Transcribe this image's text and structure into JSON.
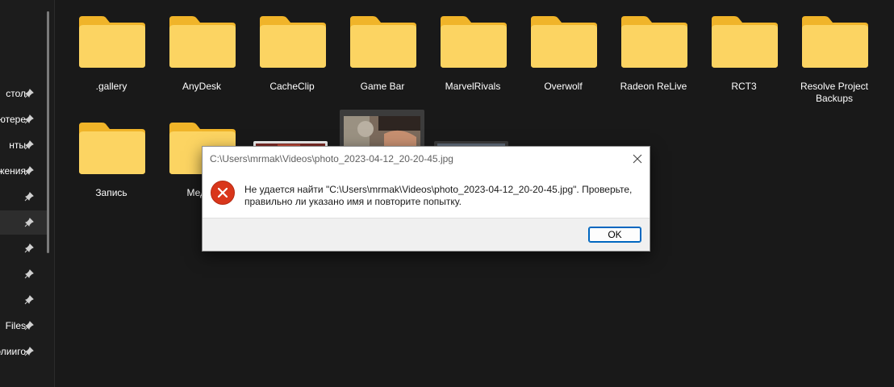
{
  "sidebar": {
    "items": [
      {
        "label": "стол"
      },
      {
        "label": "ьютере"
      },
      {
        "label": "нты"
      },
      {
        "label": "жения"
      },
      {
        "label": ""
      },
      {
        "label": ""
      },
      {
        "label": ""
      },
      {
        "label": ""
      },
      {
        "label": ""
      },
      {
        "label": "Files"
      },
      {
        "label": "олииго"
      }
    ],
    "selected_index": 5
  },
  "folders": [
    {
      "name": ".gallery"
    },
    {
      "name": "AnyDesk"
    },
    {
      "name": "CacheClip"
    },
    {
      "name": "Game Bar"
    },
    {
      "name": "MarvelRivals"
    },
    {
      "name": "Overwolf"
    },
    {
      "name": "Radeon ReLive"
    },
    {
      "name": "RCT3"
    },
    {
      "name": "Resolve Project Backups"
    },
    {
      "name": "Запись"
    },
    {
      "name": "Медиа"
    }
  ],
  "dialog": {
    "title": "C:\\Users\\mrmak\\Videos\\photo_2023-04-12_20-20-45.jpg",
    "message_line1": "Не удается найти \"C:\\Users\\mrmak\\Videos\\photo_2023-04-12_20-20-45.jpg\". Проверьте,",
    "message_line2": "правильно ли указано имя и повторите попытку.",
    "ok_label": "OK",
    "close_icon": "close-icon",
    "status_icon": "error-icon"
  },
  "colors": {
    "background": "#191919",
    "folder_front": "#fcd462",
    "folder_back": "#f0b429",
    "error_red": "#d9361b",
    "accent": "#0067c0"
  }
}
